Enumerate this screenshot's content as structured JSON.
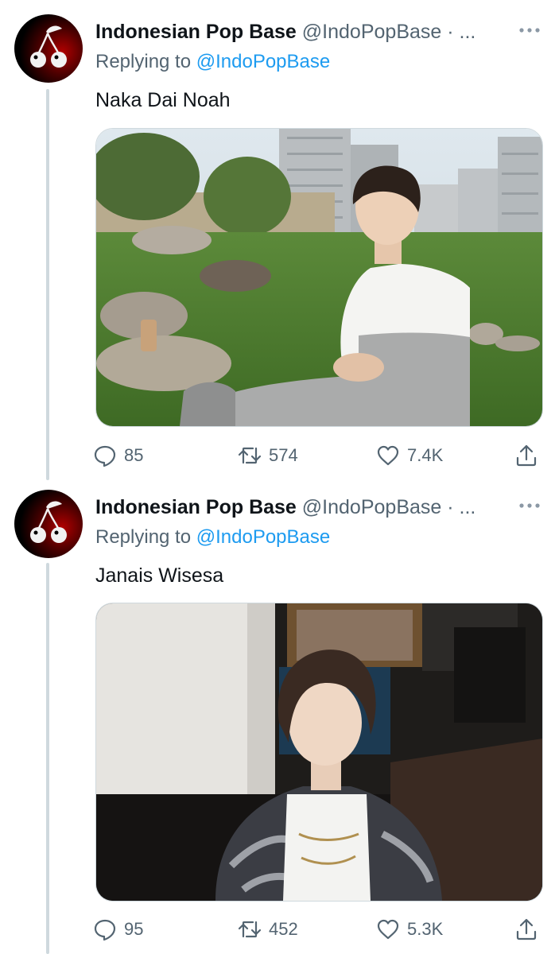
{
  "tweets": [
    {
      "display_name": "Indonesian Pop Base",
      "handle": "@IndoPopBase · ...",
      "replying_label": "Replying to",
      "replying_handle": "@IndoPopBase",
      "text": "Naka Dai Noah",
      "replies": "85",
      "retweets": "574",
      "likes": "7.4K"
    },
    {
      "display_name": "Indonesian Pop Base",
      "handle": "@IndoPopBase · ...",
      "replying_label": "Replying to",
      "replying_handle": "@IndoPopBase",
      "text": "Janais Wisesa",
      "replies": "95",
      "retweets": "452",
      "likes": "5.3K"
    }
  ],
  "icons": {
    "avatar": "cherry-logo",
    "more": "more-horizontal-icon",
    "reply": "reply-icon",
    "retweet": "retweet-icon",
    "like": "heart-icon",
    "share": "share-icon"
  },
  "colors": {
    "link": "#1d9bf0",
    "secondary_text": "#536471",
    "thread_line": "#cfd9de"
  }
}
